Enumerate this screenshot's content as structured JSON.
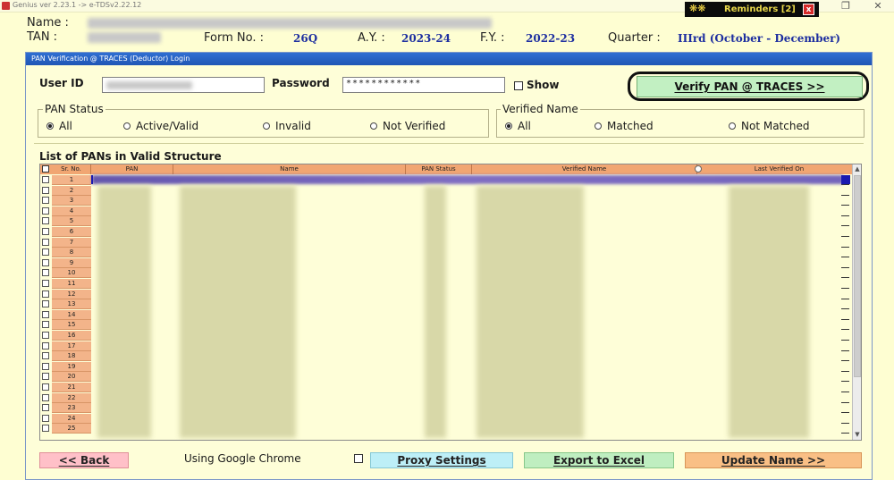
{
  "titlebar": {
    "text": "Genius ver 2.23.1 -> e-TDSv2.22.12"
  },
  "reminders": {
    "label": "Reminders [2]",
    "close": "x"
  },
  "header": {
    "name_label": "Name :",
    "tan_label": "TAN :",
    "form_no_label": "Form No. :",
    "form_no": "26Q",
    "ay_label": "A.Y. :",
    "ay": "2023-24",
    "fy_label": "F.Y. :",
    "fy": "2022-23",
    "quarter_label": "Quarter :",
    "quarter": "IIIrd (October - December)"
  },
  "panel": {
    "title": "PAN Verification @ TRACES (Deductor) Login",
    "user_id_label": "User ID",
    "password_label": "Password",
    "password_mask": "************",
    "show_label": "Show",
    "verify_button": "Verify PAN @ TRACES >>"
  },
  "pan_status": {
    "title": "PAN Status",
    "options": [
      "All",
      "Active/Valid",
      "Invalid",
      "Not Verified"
    ],
    "selected": "All"
  },
  "verified_name": {
    "title": "Verified Name",
    "options": [
      "All",
      "Matched",
      "Not Matched"
    ],
    "selected": "All"
  },
  "list": {
    "title": "List of PANs in Valid Structure",
    "columns": [
      "Sr. No.",
      "PAN",
      "Name",
      "PAN Status",
      "Verified Name",
      "Last Verified On"
    ],
    "rows": [
      "1",
      "2",
      "3",
      "4",
      "5",
      "6",
      "7",
      "8",
      "9",
      "10",
      "11",
      "12",
      "13",
      "14",
      "15",
      "16",
      "17",
      "18",
      "19",
      "20",
      "21",
      "22",
      "23",
      "24",
      "25"
    ]
  },
  "footer": {
    "back": "<< Back",
    "browser_label": "Using Google Chrome",
    "proxy": "Proxy Settings",
    "export": "Export to Excel",
    "update": "Update Name >>"
  },
  "colors": {
    "background": "#fefed2",
    "header_value": "#1e2fa0",
    "verify_btn": "#c2f0c2",
    "grid_header": "#f1a672",
    "back_btn": "#ffc0c8",
    "proxy_btn": "#bdeff7",
    "export_btn": "#bfeec0",
    "update_btn": "#f9bf85"
  }
}
